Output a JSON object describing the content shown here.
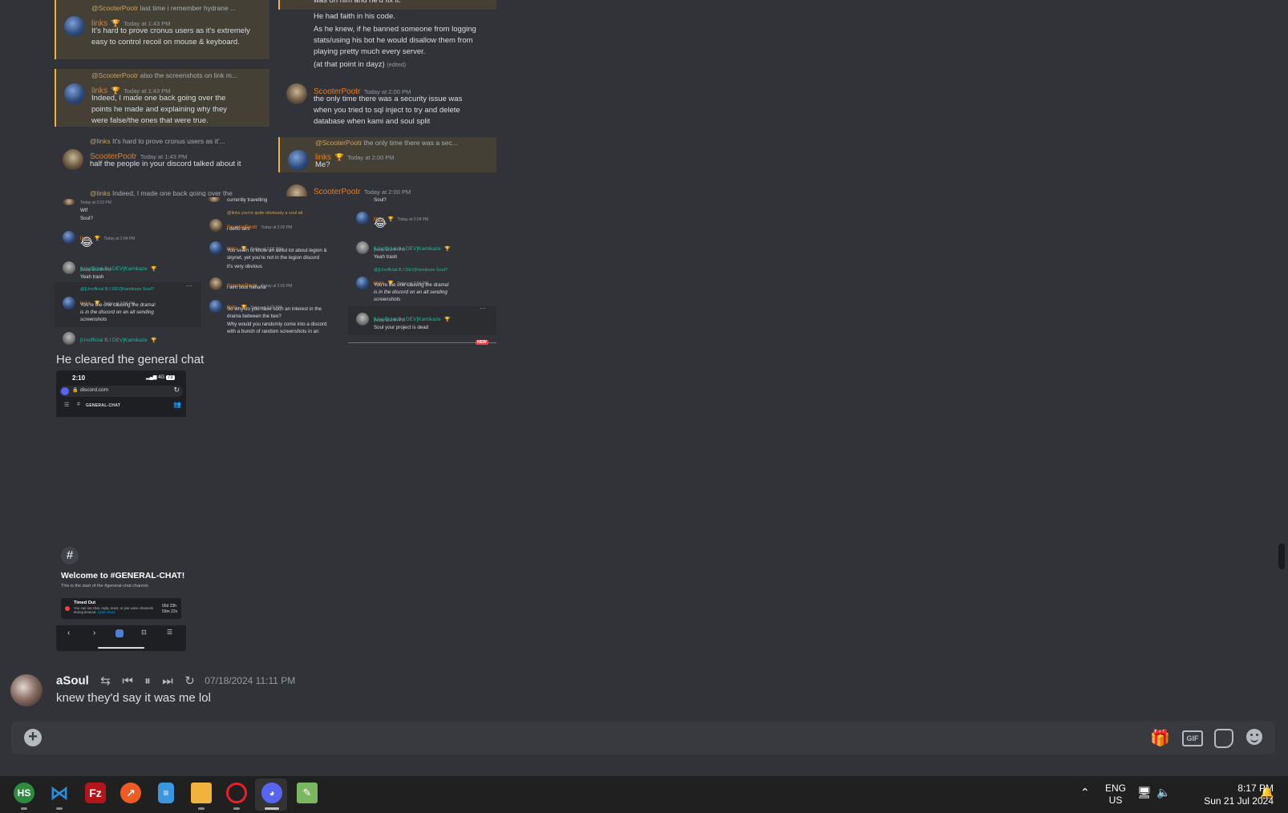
{
  "ss1": {
    "left": [
      {
        "reply_name": "@ScooterPootr",
        "reply_text": "last time i remember hydrane ...",
        "author": "links",
        "ts": "Today at 1:43 PM",
        "body": "It's hard to prove cronus users as it's extremely easy to control recoil on mouse & keyboard."
      },
      {
        "reply_name": "@ScooterPootr",
        "reply_text": "also the screenshots on link m...",
        "author": "links",
        "ts": "Today at 1:43 PM",
        "body": "Indeed, I made one back going over the points he made and explaining why they were false/the ones that were true."
      },
      {
        "reply_name": "@links",
        "reply_text": "It's hard to prove cronus users as it'...",
        "author": "ScooterPootr",
        "ts": "Today at 1:43 PM",
        "body": "half the people in your discord talked about it"
      },
      {
        "reply_name": "@links",
        "reply_text": "Indeed, I made one back going over the"
      }
    ],
    "right": {
      "cont": [
        "was on him and he'd fix it.",
        "He had faith in his code.",
        "As he knew, if he banned someone from logging stats/using his bot he would disallow them from playing pretty much every server.",
        "(at that point in dayz)"
      ],
      "edited": "(edited)",
      "m1": {
        "author": "ScooterPootr",
        "ts": "Today at 2:00 PM",
        "body": "the only time there was a security issue was when you tried to sql inject to try and delete database when kami and soul split"
      },
      "m2": {
        "reply_name": "@ScooterPootr",
        "reply_text": "the only time there was a sec...",
        "author": "links",
        "ts": "Today at 2:00 PM",
        "body": "Me?"
      },
      "m3": {
        "author": "ScooterPootr",
        "ts": "Today at 2:00 PM"
      }
    }
  },
  "ss2": {
    "c1": {
      "ts0": "Today at 2:03 PM",
      "l0a": "Wtf",
      "l0b": "Soul?",
      "m1": {
        "author": "links",
        "ts": "Today at 2:04 PM",
        "emoji": "😂"
      },
      "m2": {
        "author": "[Unofficial B.I DEV]Kamikaze",
        "ts": "Today at 2:04 PM",
        "body": "Yeah trash"
      },
      "m3": {
        "reply": "@[Unofficial B.I DEV]Kamikaze Soul?",
        "author": "links",
        "ts": "Today at 2:04 PM",
        "body": "You're the one causing the drama!",
        "italic": "is in the discord on an alt sending screenshots"
      },
      "m4": {
        "author": "[Unofficial B.I DEV]Kamikaze"
      }
    },
    "c2": {
      "l0": "currently travelling",
      "m1": {
        "reply": "@links you're quite obviously a soul alt",
        "author": "ScooterPootr",
        "ts": "Today at 2:02 PM",
        "body": "i deffo aint"
      },
      "m2": {
        "author": "links",
        "ts": "Today at 2:02 PM",
        "body": "You seem to know an awful lot about legion & skynet, yet you're not in the legion discord",
        "body2": "it's very obvious"
      },
      "m3": {
        "author": "ScooterPootr",
        "ts": "Today at 2:02 PM",
        "body": "i aint soul hahaha"
      },
      "m4": {
        "author": "links",
        "ts": "Today at 2:02 PM",
        "body": "So why do you have such an interest in the drama between the two?",
        "body2": "Why would you randomly come into a discord with a bunch of random screenshots in an"
      }
    },
    "c3": {
      "l0": "Soul?",
      "m1": {
        "author": "links",
        "ts": "Today at 2:04 PM",
        "emoji": "😂"
      },
      "m2": {
        "author": "[Unofficial B.I DEV]Kamikaze",
        "ts": "Today at 2:04 PM",
        "body": "Yeah trash"
      },
      "m3": {
        "reply": "@[Unofficial B.I DEV]Kamikaze Soul?",
        "author": "links",
        "ts": "Today at 2:04 PM",
        "body": "You're the one causing the drama!",
        "italic": "is in the discord on an alt sending screenshots"
      },
      "m4": {
        "author": "[Unofficial B.I DEV]Kamikaze",
        "ts": "Today at 2:04 PM",
        "body": "Soul your project is dead"
      },
      "new_badge": "NEW"
    }
  },
  "caption": "He cleared the general chat",
  "phone": {
    "time": "2:10",
    "status": "4G",
    "battery": "73",
    "url": "discord.com",
    "channel": "GENERAL-CHAT",
    "welcome": "Welcome to #GENERAL-CHAT!",
    "start_text": "This is the start of the #general-chat channel.",
    "timeout_title": "Timed Out",
    "timeout_body": "You can not chat, reply, react, or join voice channels during timeout.",
    "learn_more": "Learn more",
    "timeout_t1": "06d 23h",
    "timeout_t2": "59m 22s"
  },
  "message": {
    "author": "aSoul",
    "timestamp": "07/18/2024 11:11 PM",
    "body": "knew they'd say it was me lol"
  },
  "taskbar": {
    "lang1": "ENG",
    "lang2": "US",
    "time": "8:17 PM",
    "date": "Sun 21 Jul 2024",
    "apps": [
      "HS",
      "VS Code",
      "FileZilla",
      "Postman",
      "Notepad",
      "File Explorer",
      "Opera",
      "Discord",
      "Editor"
    ]
  },
  "icons": {
    "gif_label": "GIF"
  },
  "colors": {
    "bg": "#313338",
    "input": "#383a40",
    "highlight": "#444036",
    "accent_orange": "#e67e22",
    "accent_teal": "#1abc9c",
    "taskbar": "#202020"
  }
}
